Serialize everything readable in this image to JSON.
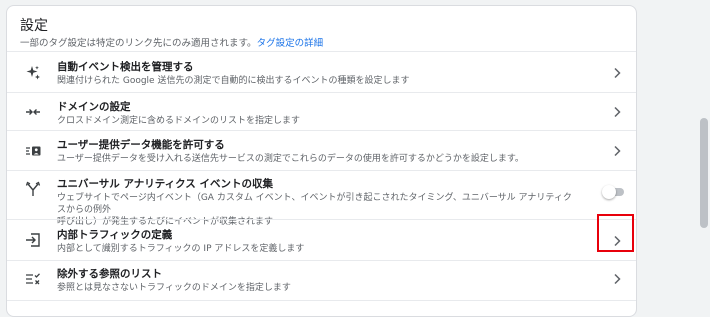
{
  "header": {
    "title": "設定",
    "subtitle": "一部のタグ設定は特定のリンク先にのみ適用されます。",
    "link": "タグ設定の詳細"
  },
  "rows": [
    {
      "title": "自動イベント検出を管理する",
      "desc": "関連付けられた Google 送信先の測定で自動的に検出するイベントの種類を設定します",
      "control": "chevron",
      "icon": "sparkle-icon"
    },
    {
      "title": "ドメインの設定",
      "desc": "クロスドメイン測定に含めるドメインのリストを指定します",
      "control": "chevron",
      "icon": "merge-arrows-icon"
    },
    {
      "title": "ユーザー提供データ機能を許可する",
      "desc": "ユーザー提供データを受け入れる送信先サービスの測定でこれらのデータの使用を許可するかどうかを設定します。",
      "control": "chevron",
      "icon": "contact-card-icon"
    },
    {
      "title": "ユニバーサル アナリティクス イベントの収集",
      "desc": "ウェブサイトでページ内イベント（GA カスタム イベント、イベントが引き起こされたタイミング、ユニバーサル アナリティクスからの例外",
      "desc2": "呼び出し）が発生するたびにイベントが収集されます",
      "control": "toggle",
      "toggle_on": false,
      "icon": "fork-icon"
    },
    {
      "title": "内部トラフィックの定義",
      "desc": "内部として識別するトラフィックの IP アドレスを定義します",
      "control": "chevron",
      "icon": "login-icon"
    },
    {
      "title": "除外する参照のリスト",
      "desc": "参照とは見なさないトラフィックのドメインを指定します",
      "control": "chevron",
      "icon": "list-check-icon"
    }
  ],
  "colors": {
    "accent": "#1a73e8",
    "highlight": "#e8000b"
  }
}
